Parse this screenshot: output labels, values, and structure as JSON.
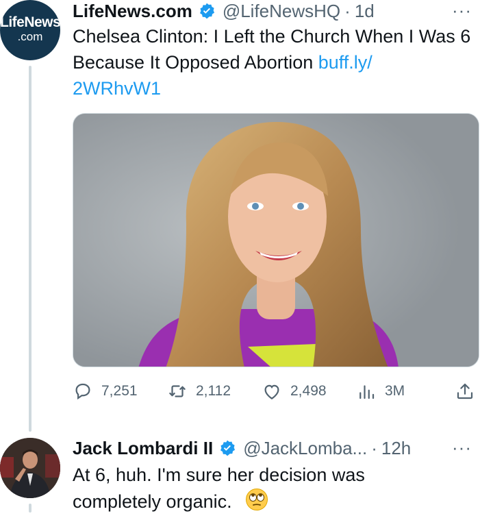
{
  "tweet": {
    "avatar": {
      "text_top": "LifeNews",
      "text_bottom": ".com"
    },
    "author_name": "LifeNews.com",
    "handle": "@LifeNewsHQ",
    "separator": "·",
    "time": "1d",
    "more": "···",
    "text": "Chelsea Clinton: I Left the Church When I Was 6 Because It Opposed Abortion ",
    "link_line1": "buff.ly/",
    "link_line2": "2WRhvW1",
    "actions": {
      "replies": "7,251",
      "retweets": "2,112",
      "likes": "2,498",
      "views": "3M"
    }
  },
  "reply": {
    "author_name": "Jack Lombardi II",
    "handle": "@JackLomba...",
    "separator": "·",
    "time": "12h",
    "more": "···",
    "text": "At 6, huh.  I'm sure her decision was completely organic."
  },
  "colors": {
    "accent": "#1d9bf0",
    "secondary_text": "#536471",
    "thread_line": "#cfd9de",
    "avatar_bg": "#14364f"
  },
  "icons": [
    "verified-badge-icon",
    "more-icon",
    "reply-icon",
    "retweet-icon",
    "like-icon",
    "views-icon",
    "share-icon",
    "rolling-eyes-emoji-icon"
  ]
}
